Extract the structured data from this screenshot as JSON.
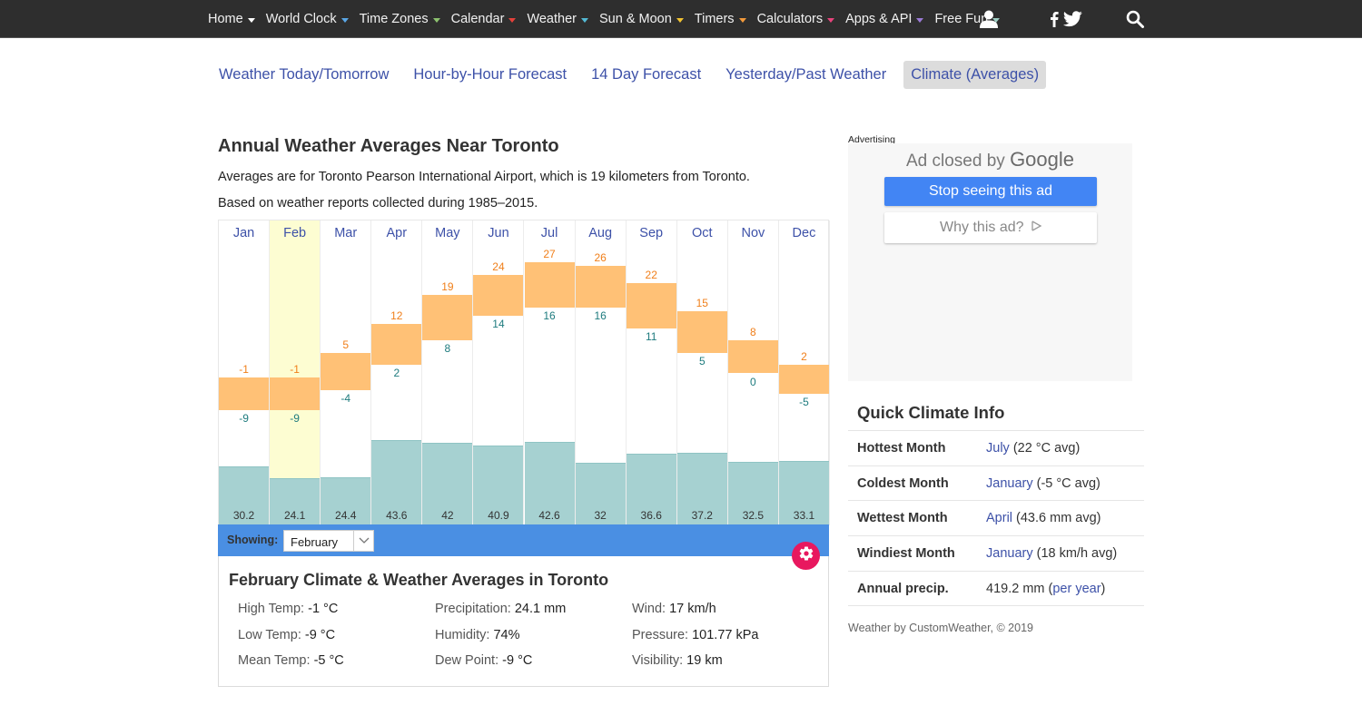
{
  "nav": {
    "items": [
      {
        "label": "Home",
        "caret_color": "#ffffff"
      },
      {
        "label": "World Clock",
        "caret_color": "#5aa7e6"
      },
      {
        "label": "Time Zones",
        "caret_color": "#8dc26f"
      },
      {
        "label": "Calendar",
        "caret_color": "#e5413a"
      },
      {
        "label": "Weather",
        "caret_color": "#53b9d4"
      },
      {
        "label": "Sun & Moon",
        "caret_color": "#f2c331"
      },
      {
        "label": "Timers",
        "caret_color": "#f39a3b"
      },
      {
        "label": "Calculators",
        "caret_color": "#e8447c"
      },
      {
        "label": "Apps & API",
        "caret_color": "#9b7ad6"
      },
      {
        "label": "Free Fun",
        "caret_color": "#9fcfc4"
      }
    ],
    "icons": [
      "user-icon",
      "facebook-icon",
      "twitter-icon",
      "search-icon"
    ]
  },
  "subtabs": [
    {
      "label": "Weather Today/Tomorrow",
      "active": false
    },
    {
      "label": "Hour-by-Hour Forecast",
      "active": false
    },
    {
      "label": "14 Day Forecast",
      "active": false
    },
    {
      "label": "Yesterday/Past Weather",
      "active": false
    },
    {
      "label": "Climate (Averages)",
      "active": true
    }
  ],
  "main": {
    "title": "Annual Weather Averages Near Toronto",
    "intro1": "Averages are for Toronto Pearson International Airport, which is 19 kilometers from Toronto.",
    "intro2": "Based on weather reports collected during 1985–2015."
  },
  "chart_data": {
    "type": "bar",
    "title": "Annual Weather Averages Near Toronto",
    "categories": [
      "Jan",
      "Feb",
      "Mar",
      "Apr",
      "May",
      "Jun",
      "Jul",
      "Aug",
      "Sep",
      "Oct",
      "Nov",
      "Dec"
    ],
    "series": [
      {
        "name": "High Temp (°C)",
        "values": [
          -1,
          -1,
          5,
          12,
          19,
          24,
          27,
          26,
          22,
          15,
          8,
          2
        ],
        "color": "#ffc176"
      },
      {
        "name": "Low Temp (°C)",
        "values": [
          -9,
          -9,
          -4,
          2,
          8,
          14,
          16,
          16,
          11,
          5,
          0,
          -5
        ],
        "color": "#ffc176"
      },
      {
        "name": "Precipitation (mm)",
        "values": [
          30.2,
          24.1,
          24.4,
          43.6,
          42,
          40.9,
          42.6,
          32,
          36.6,
          37.2,
          32.5,
          33.1
        ],
        "color": "#a6d1d1"
      }
    ],
    "selected_category": "Feb",
    "colors": {
      "high_label": "#f07f1a",
      "low_label": "#1e7b7e",
      "selected_bg": "#fdfdd2"
    }
  },
  "showing": {
    "label": "Showing:",
    "selected": "February"
  },
  "detail": {
    "title": "February Climate & Weather Averages in Toronto",
    "stats": [
      {
        "label": "High Temp:",
        "value": "-1 °C"
      },
      {
        "label": "Low Temp:",
        "value": "-9 °C"
      },
      {
        "label": "Mean Temp:",
        "value": "-5 °C"
      },
      {
        "label": "Precipitation:",
        "value": "24.1 mm"
      },
      {
        "label": "Humidity:",
        "value": "74%"
      },
      {
        "label": "Dew Point:",
        "value": "-9 °C"
      },
      {
        "label": "Wind:",
        "value": "17 km/h"
      },
      {
        "label": "Pressure:",
        "value": "101.77 kPa"
      },
      {
        "label": "Visibility:",
        "value": "19 km"
      }
    ]
  },
  "ad": {
    "label": "Advertising",
    "closed_prefix": "Ad closed by",
    "closed_brand": "Google",
    "stop_button": "Stop seeing this ad",
    "why_button": "Why this ad?"
  },
  "quick_climate": {
    "title": "Quick Climate Info",
    "rows": [
      {
        "key": "Hottest Month",
        "link": "July",
        "rest": " (22 °C avg)"
      },
      {
        "key": "Coldest Month",
        "link": "January",
        "rest": " (-5 °C avg)"
      },
      {
        "key": "Wettest Month",
        "link": "April",
        "rest": " (43.6 mm avg)"
      },
      {
        "key": "Windiest Month",
        "link": "January",
        "rest": " (18 km/h avg)"
      },
      {
        "key": "Annual precip.",
        "pre": "419.2 mm (",
        "link": "per year",
        "rest": ")"
      }
    ]
  },
  "credit": "Weather by CustomWeather, © 2019"
}
